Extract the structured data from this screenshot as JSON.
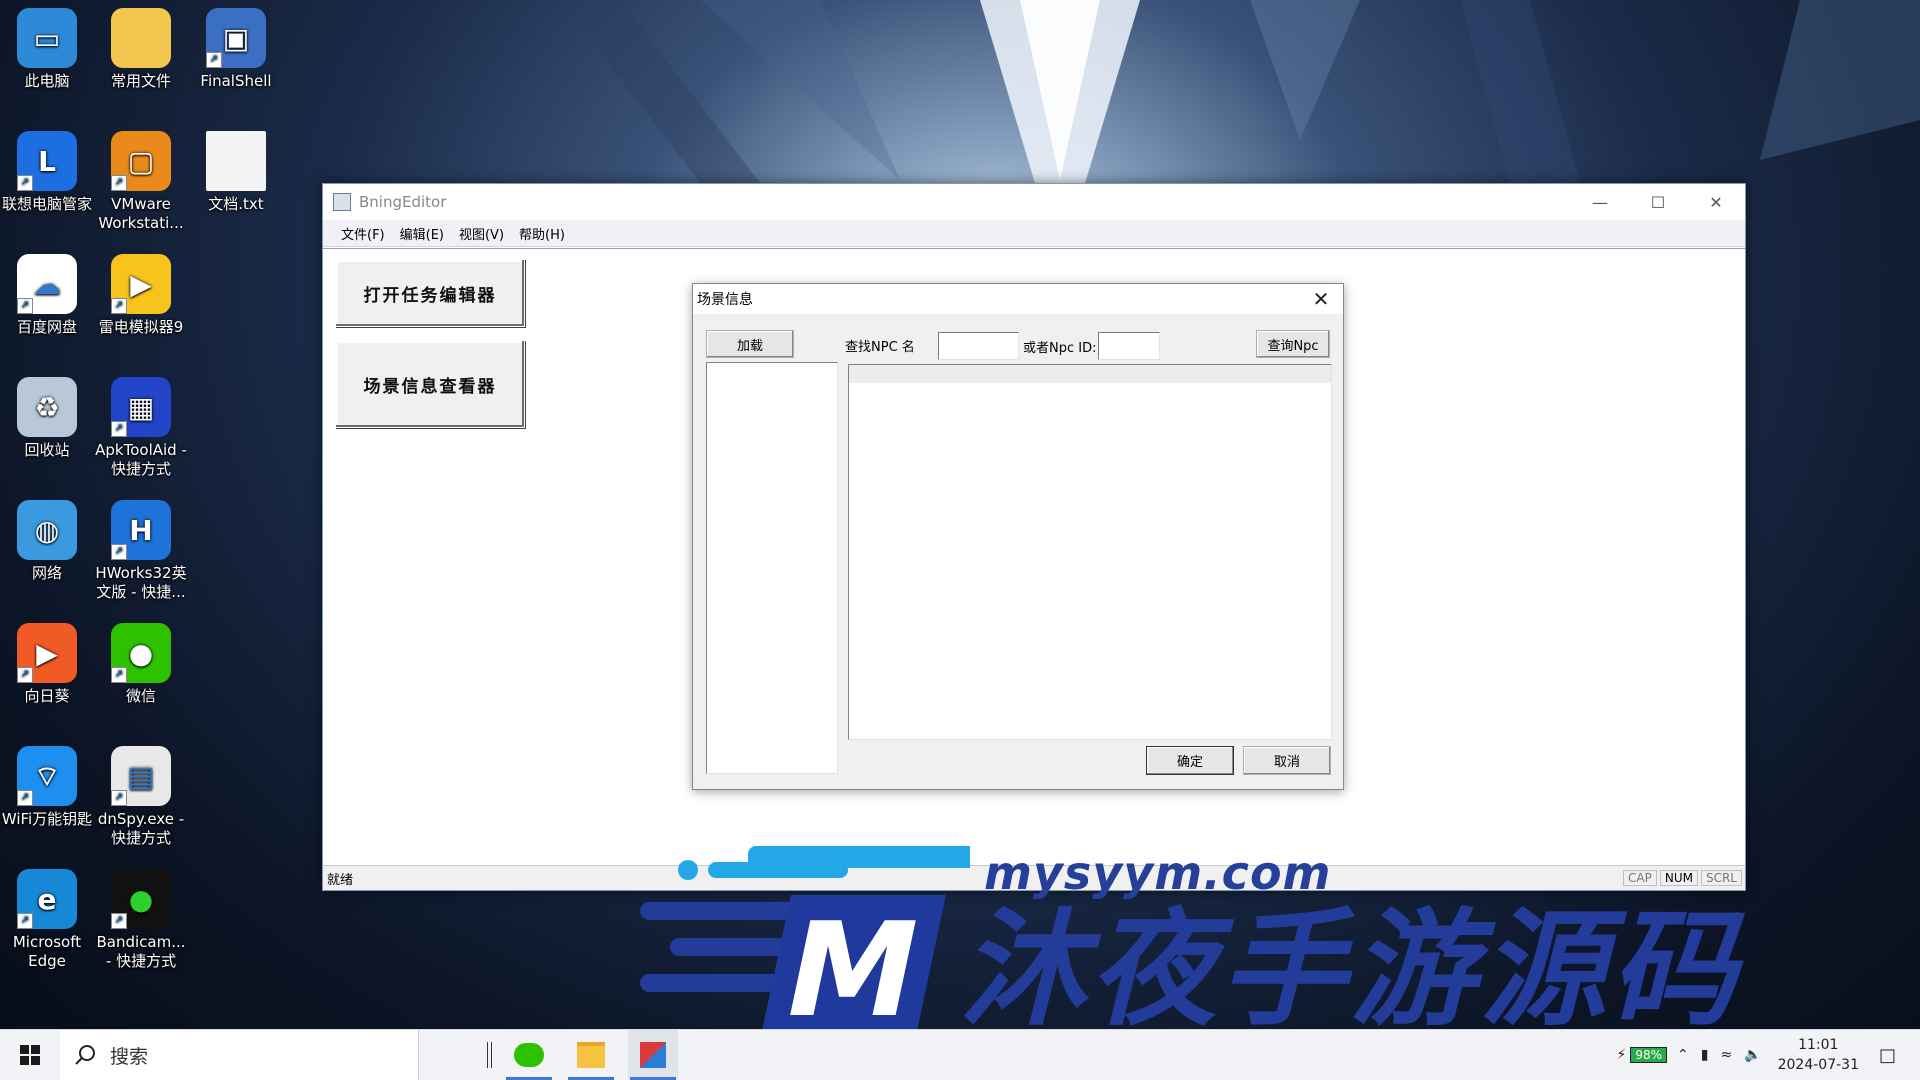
{
  "desktop": {
    "icons": [
      {
        "label": "此电脑",
        "icon": "computer-icon"
      },
      {
        "label": "常用文件",
        "icon": "folder-icon"
      },
      {
        "label": "FinalShell",
        "icon": "finalshell-icon"
      },
      {
        "label": "联想电脑管家",
        "icon": "lenovo-manager-icon"
      },
      {
        "label": "VMware Workstati...",
        "icon": "vmware-icon"
      },
      {
        "label": "文档.txt",
        "icon": "text-file-icon"
      },
      {
        "label": "百度网盘",
        "icon": "baidu-netdisk-icon"
      },
      {
        "label": "雷电模拟器9",
        "icon": "ldplayer-icon"
      },
      {
        "label": "回收站",
        "icon": "recycle-bin-icon"
      },
      {
        "label": "ApkToolAid - 快捷方式",
        "icon": "apktoolaid-icon"
      },
      {
        "label": "网络",
        "icon": "network-icon"
      },
      {
        "label": "HWorks32英文版 - 快捷...",
        "icon": "hworks-icon"
      },
      {
        "label": "向日葵",
        "icon": "sunlogin-icon"
      },
      {
        "label": "微信",
        "icon": "wechat-icon"
      },
      {
        "label": "WiFi万能钥匙",
        "icon": "wifi-key-icon"
      },
      {
        "label": "dnSpy.exe - 快捷方式",
        "icon": "dnspy-icon"
      },
      {
        "label": "Microsoft Edge",
        "icon": "edge-icon"
      },
      {
        "label": "Bandicam... - 快捷方式",
        "icon": "bandicam-icon"
      }
    ]
  },
  "window": {
    "title": "BningEditor",
    "menu": [
      "文件(F)",
      "编辑(E)",
      "视图(V)",
      "帮助(H)"
    ],
    "buttons": {
      "open_task_editor": "打开任务编辑器",
      "scene_viewer": "场景信息查看器"
    },
    "status": {
      "message": "就绪",
      "indicators": [
        "CAP",
        "NUM",
        "SCRL"
      ]
    }
  },
  "dialog": {
    "title": "场景信息",
    "load_button": "加载",
    "find_npc_label": "查找NPC 名",
    "or_npc_id_label": "或者Npc ID:",
    "npc_name_value": "",
    "npc_id_value": "",
    "query_button": "查询Npc",
    "ok_button": "确定",
    "cancel_button": "取消"
  },
  "watermark": {
    "url": "mysyym.com",
    "brand": "沐夜手游源码",
    "logo_letter": "M"
  },
  "taskbar": {
    "search_placeholder": "搜索",
    "apps": [
      "wechat-icon",
      "file-explorer-icon",
      "bningeditor-icon"
    ],
    "battery": "98%",
    "time": "11:01",
    "date": "2024-07-31"
  },
  "colors": {
    "brand_blue": "#233c9a",
    "accent_cyan": "#22a8e6",
    "taskbar_active": "#3b78d8"
  }
}
